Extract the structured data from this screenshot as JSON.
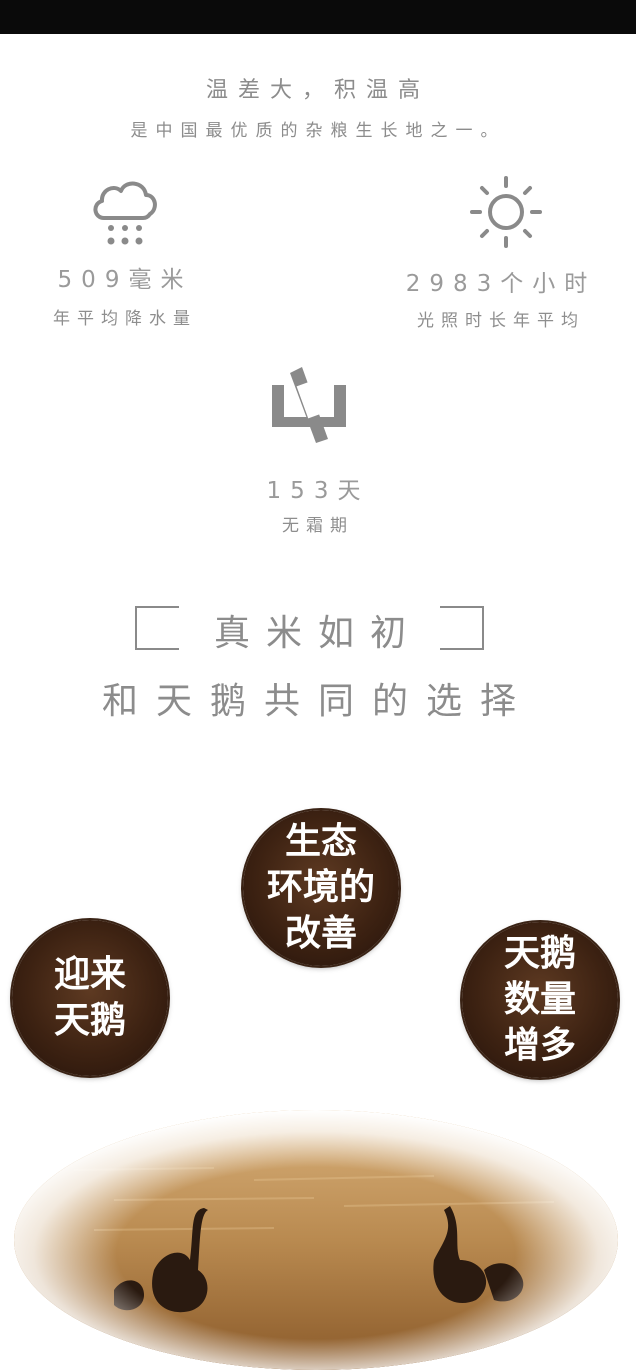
{
  "intro": {
    "headline": "温差大，积温高",
    "subline": "是中国最优质的杂粮生长地之一。"
  },
  "stats": [
    {
      "value": "509毫米",
      "label": "年平均降水量",
      "icon": "rain-cloud-icon"
    },
    {
      "value": "2983个小时",
      "label": "光照时长年平均",
      "icon": "sun-icon"
    },
    {
      "value": "153天",
      "label": "无霜期",
      "icon": "frost-free-icon"
    }
  ],
  "slogan": {
    "line1": "真米如初",
    "line2": "和天鹅共同的选择"
  },
  "circles": [
    {
      "text": "生态\n环境的\n改善"
    },
    {
      "text": "迎来\n天鹅"
    },
    {
      "text": "天鹅\n数量\n增多"
    }
  ],
  "photo": {
    "subject": "swans-on-water-photo"
  },
  "colors": {
    "topbar": "#0a0a0a",
    "text_gray": "#8c8c8c",
    "circle_brown": "#3d2212",
    "photo_gold": "#b88a52"
  }
}
